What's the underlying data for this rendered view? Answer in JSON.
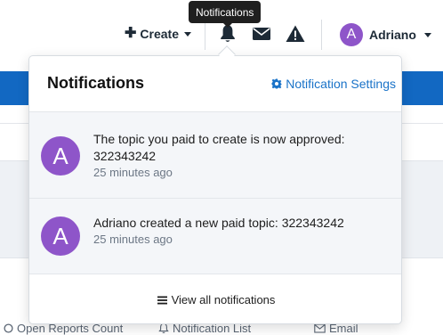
{
  "navbar": {
    "create_label": "Create",
    "user_name": "Adriano",
    "user_initial": "A"
  },
  "tooltip": {
    "text": "Notifications"
  },
  "dropdown": {
    "title": "Notifications",
    "settings_label": "Notification Settings",
    "items": [
      {
        "initial": "A",
        "text": "The topic you paid to create is now approved: 322343242",
        "time": "25 minutes ago"
      },
      {
        "initial": "A",
        "text": "Adriano created a new paid topic: 322343242",
        "time": "25 minutes ago"
      }
    ],
    "footer_label": "View all notifications"
  },
  "bottom_bar": {
    "open_reports": "Open Reports Count",
    "notification_list": "Notification List",
    "email": "Email"
  },
  "colors": {
    "brand_blue": "#1268c2",
    "link_blue": "#1a73c8",
    "avatar_purple": "#8e55c9"
  }
}
